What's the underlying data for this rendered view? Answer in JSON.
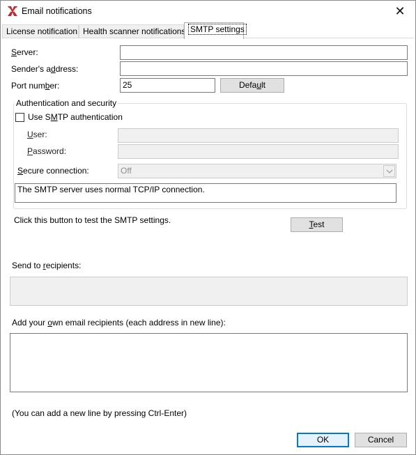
{
  "window": {
    "title": "Email notifications",
    "close_glyph": "✕"
  },
  "tabs": [
    {
      "label": "License notification",
      "active": false
    },
    {
      "label": "Health scanner notifications",
      "active": false
    },
    {
      "label": "SMTP settings",
      "active": true
    }
  ],
  "smtp": {
    "server_label_pre": "",
    "server_label_u": "S",
    "server_label_post": "erver:",
    "server_value": "",
    "sender_label_pre": "Sender's a",
    "sender_label_u": "d",
    "sender_label_post": "dress:",
    "sender_value": "",
    "port_label_pre": "Port num",
    "port_label_u": "b",
    "port_label_post": "er:",
    "port_value": "25",
    "default_button_pre": "Defa",
    "default_button_u": "u",
    "default_button_post": "lt"
  },
  "auth": {
    "group_title": "Authentication and security",
    "use_auth_pre": "Use S",
    "use_auth_u": "M",
    "use_auth_post": "TP authentication",
    "use_auth_checked": false,
    "user_label_pre": "",
    "user_label_u": "U",
    "user_label_post": "ser:",
    "user_value": "",
    "password_label_pre": "",
    "password_label_u": "P",
    "password_label_post": "assword:",
    "password_value": "",
    "secure_label_pre": "",
    "secure_label_u": "S",
    "secure_label_post": "ecure connection:",
    "secure_value": "Off",
    "info_text": "The SMTP server uses normal TCP/IP connection."
  },
  "test": {
    "hint": "Click this button to test the SMTP settings.",
    "button_pre": "",
    "button_u": "T",
    "button_post": "est"
  },
  "recipients": {
    "send_label_pre": "Send to ",
    "send_label_u": "r",
    "send_label_post": "ecipients:",
    "own_label_pre": "Add your ",
    "own_label_u": "o",
    "own_label_post": "wn email recipients (each address in new line):",
    "own_value": "",
    "ctrl_hint": "(You can add a new line by pressing Ctrl-Enter)"
  },
  "footer": {
    "ok_label": "OK",
    "cancel_label": "Cancel"
  },
  "colors": {
    "app_icon_red": "#c4262e",
    "focus_blue": "#0078d7",
    "disabled_bg": "#f0f0f0"
  }
}
